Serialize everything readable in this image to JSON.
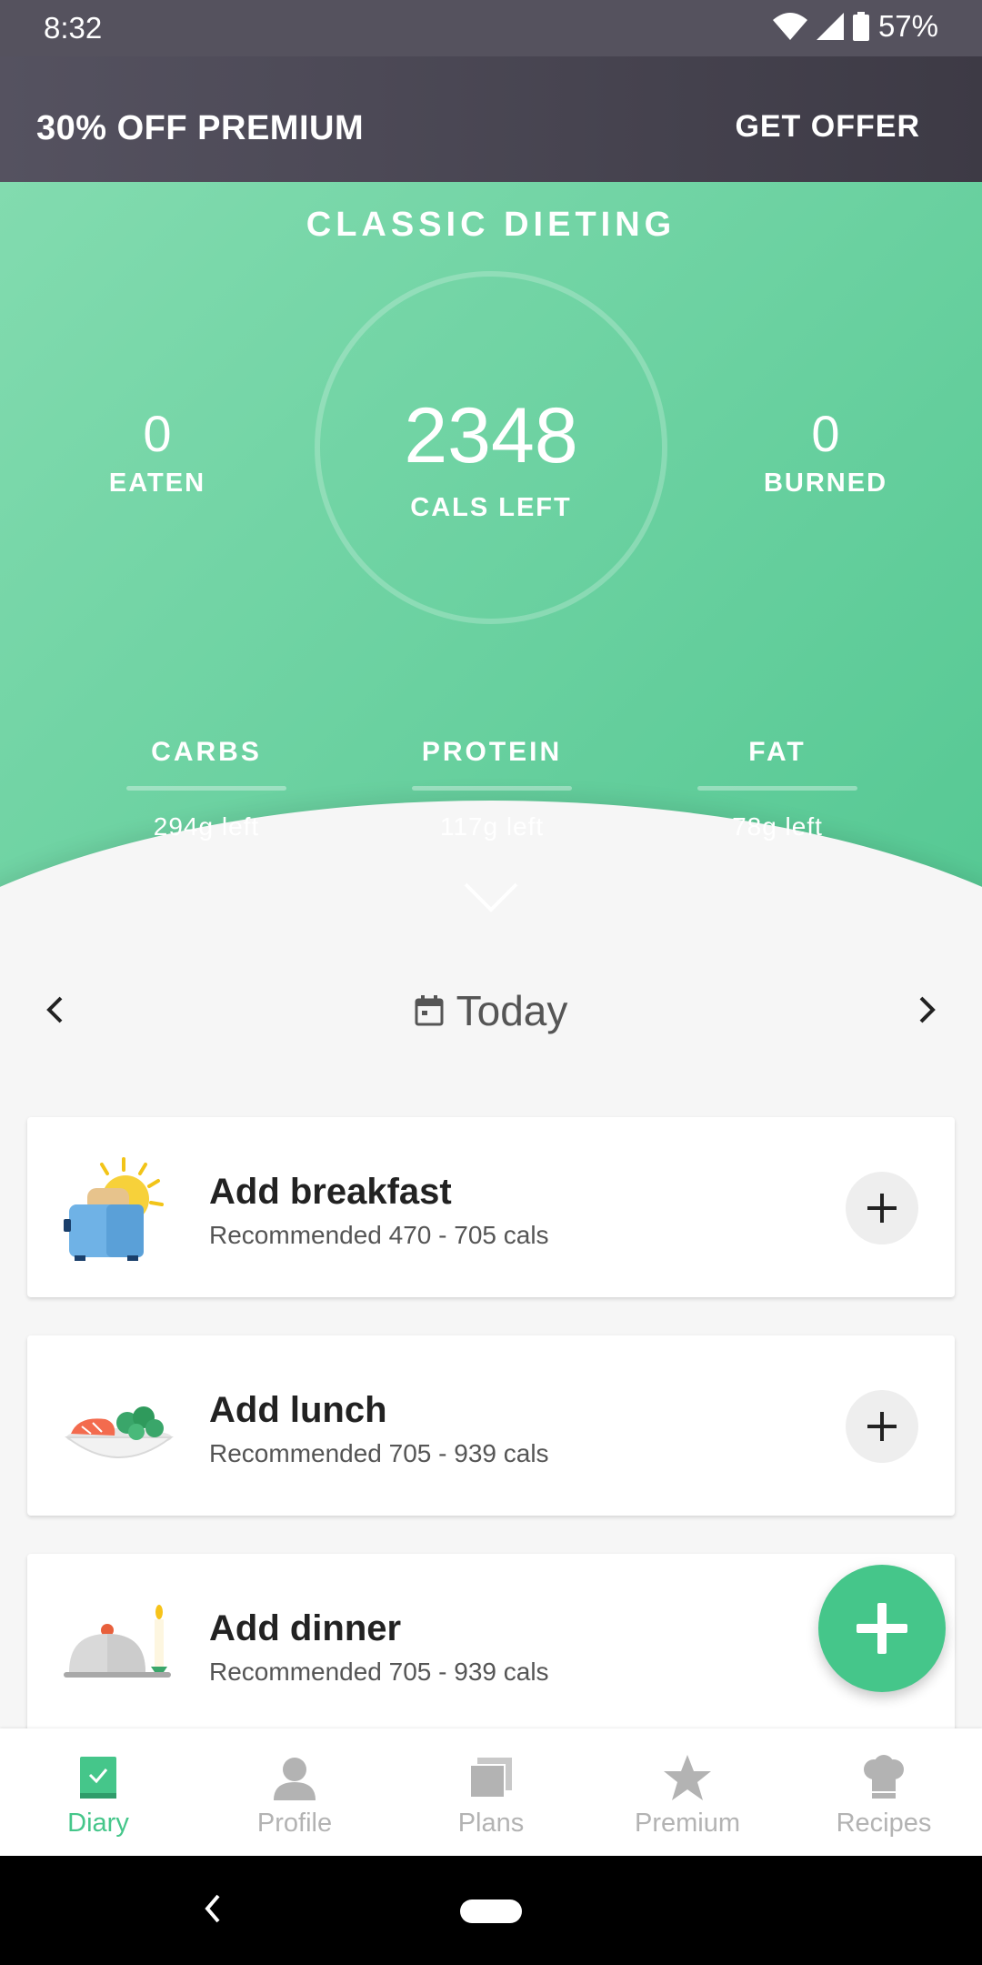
{
  "status": {
    "time": "8:32",
    "battery": "57%"
  },
  "promo": {
    "text": "30% OFF PREMIUM",
    "cta": "GET OFFER"
  },
  "summary": {
    "plan_title": "CLASSIC DIETING",
    "cals_left": "2348",
    "cals_left_label": "CALS LEFT",
    "eaten_value": "0",
    "eaten_label": "EATEN",
    "burned_value": "0",
    "burned_label": "BURNED",
    "macros": [
      {
        "name": "CARBS",
        "left": "294g left"
      },
      {
        "name": "PROTEIN",
        "left": "117g left"
      },
      {
        "name": "FAT",
        "left": "78g left"
      }
    ]
  },
  "date_nav": {
    "label": "Today"
  },
  "meals": [
    {
      "title": "Add breakfast",
      "subtitle": "Recommended 470 - 705 cals"
    },
    {
      "title": "Add lunch",
      "subtitle": "Recommended 705 - 939 cals"
    },
    {
      "title": "Add dinner",
      "subtitle": "Recommended 705 - 939 cals"
    }
  ],
  "nav": [
    {
      "label": "Diary",
      "icon": "diary-icon",
      "active": true
    },
    {
      "label": "Profile",
      "icon": "profile-icon",
      "active": false
    },
    {
      "label": "Plans",
      "icon": "plans-icon",
      "active": false
    },
    {
      "label": "Premium",
      "icon": "star-icon",
      "active": false
    },
    {
      "label": "Recipes",
      "icon": "chef-hat-icon",
      "active": false
    }
  ],
  "colors": {
    "accent": "#45c68a",
    "hero_light": "#82dbaf",
    "hero_dark": "#55c893",
    "promo_bg": "#4a4753"
  }
}
